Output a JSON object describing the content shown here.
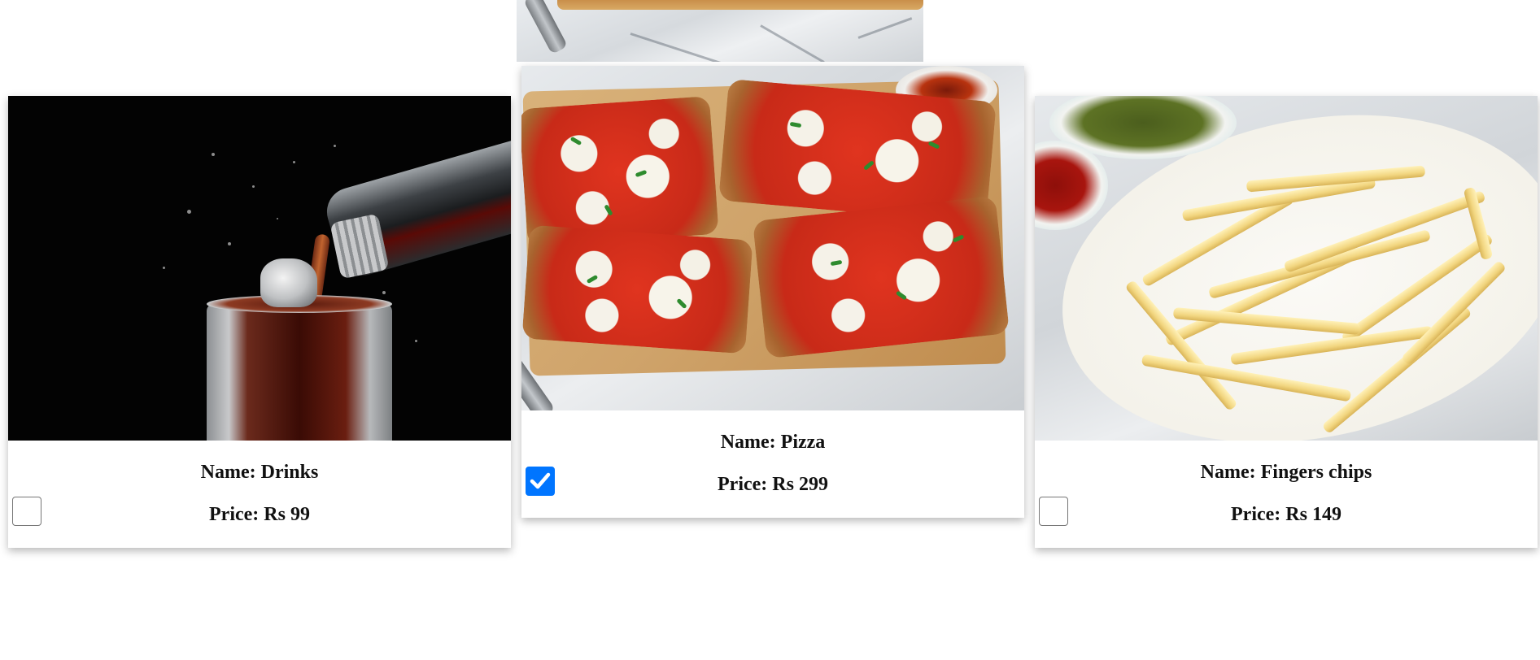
{
  "products": [
    {
      "id": "drinks",
      "image_alt": "drinks-image",
      "name_text": "Name: Drinks",
      "price_text": "Price: Rs 99",
      "checked": false
    },
    {
      "id": "pizza",
      "image_alt": "pizza-image",
      "name_text": "Name: Pizza",
      "price_text": "Price: Rs 299",
      "checked": true
    },
    {
      "id": "fingers-chips",
      "image_alt": "fingers-chips-image",
      "name_text": "Name: Fingers chips",
      "price_text": "Price: Rs 149",
      "checked": false
    }
  ],
  "colors": {
    "checkbox_checked": "#0075ff",
    "checkbox_border": "#767676",
    "text": "#111111",
    "background": "#ffffff"
  }
}
